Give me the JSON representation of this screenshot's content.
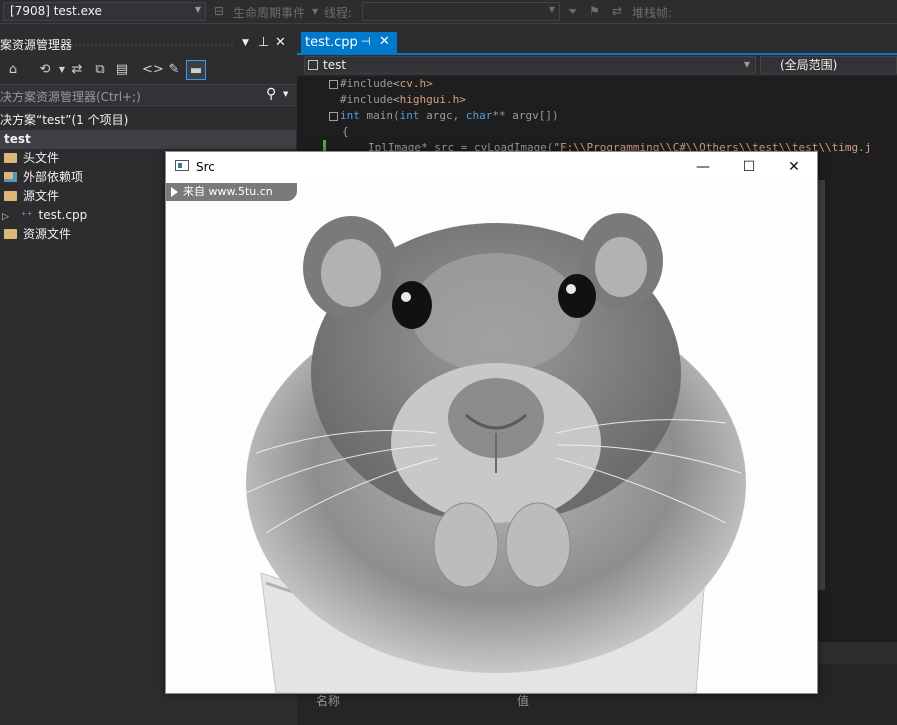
{
  "toolbar": {
    "process": "[7908] test.exe",
    "lifecycle_events": "生命周期事件",
    "thread_label": "线程:",
    "stack_frame_label": "堆栈帧:"
  },
  "solution_explorer": {
    "title": "案资源管理器",
    "search_placeholder": "决方案资源管理器(Ctrl+;)",
    "solution_label": "决方案“test”(1 个项目)",
    "project": "test",
    "items": [
      {
        "label": "头文件",
        "kind": "folder"
      },
      {
        "label": "外部依赖项",
        "kind": "folder-ext"
      },
      {
        "label": "源文件",
        "kind": "folder"
      },
      {
        "label": "test.cpp",
        "kind": "cpp"
      },
      {
        "label": "资源文件",
        "kind": "folder"
      }
    ]
  },
  "editor": {
    "tab": "test.cpp",
    "nav_scope": "test",
    "nav_global": "(全局范围)",
    "code": {
      "line1_kw": "#include",
      "line1_file": "<cv.h>",
      "line2_kw": "#include",
      "line2_file": "<highgui.h>",
      "line3_int": "int",
      "line3_main": " main(",
      "line3_int2": "int",
      "line3_argc": " argc, ",
      "line3_char": "char",
      "line3_argv": "** argv[])",
      "line4": "{",
      "line5_type": "IplImage* src = cvLoadImage(",
      "line5_str": "\"F:\\\\Programming\\\\C#\\\\Others\\\\test\\\\test\\\\timg.j"
    }
  },
  "bottom_panel": {
    "col_name": "名称",
    "col_value": "值"
  },
  "src_window": {
    "title": "Src",
    "minimize": "—",
    "maximize": "☐",
    "close": "✕",
    "watermark": "来自 www.5tu.cn"
  }
}
